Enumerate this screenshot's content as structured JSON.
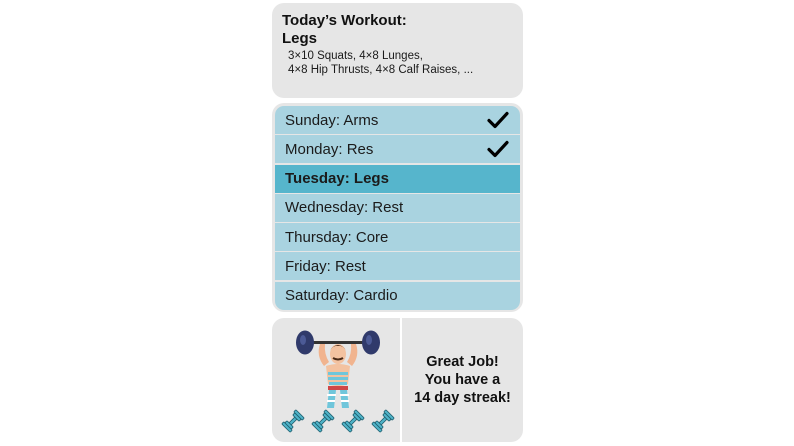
{
  "workout": {
    "heading_line1": "Today’s Workout:",
    "heading_line2": "Legs",
    "details_line1": "3×10 Squats, 4×8 Lunges,",
    "details_line2": "4×8 Hip Thrusts, 4×8 Calf Raises, ..."
  },
  "schedule": {
    "days": [
      {
        "label": "Sunday: Arms",
        "completed": true,
        "active": false
      },
      {
        "label": "Monday: Res",
        "completed": true,
        "active": false
      },
      {
        "label": "Tuesday: Legs",
        "completed": false,
        "active": true
      },
      {
        "label": "Wednesday: Rest",
        "completed": false,
        "active": false
      },
      {
        "label": "Thursday: Core",
        "completed": false,
        "active": false
      },
      {
        "label": "Friday: Rest",
        "completed": false,
        "active": false
      },
      {
        "label": "Saturday: Cardio",
        "completed": false,
        "active": false
      }
    ]
  },
  "mascot": {
    "icon": "strongman-lifting-barbell-icon",
    "dumbbell_icon": "dumbbell-icon",
    "dumbbell_count": 4
  },
  "streak": {
    "message": "Great Job!\nYou have a\n14 day streak!"
  },
  "colors": {
    "card_bg": "#e6e6e6",
    "row_bg": "#a9d3e0",
    "row_active_bg": "#56b5cc",
    "dumbbell": "#4fb3c8"
  }
}
